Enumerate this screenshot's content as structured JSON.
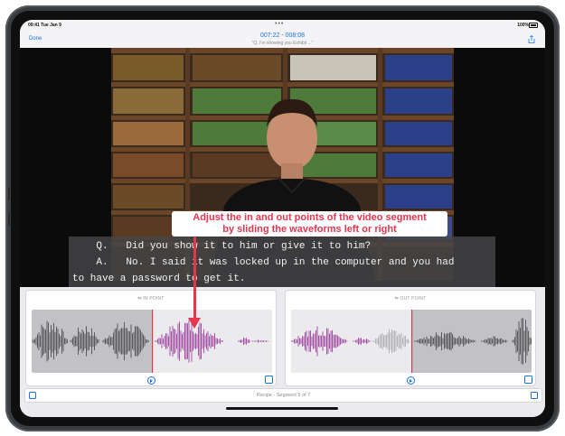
{
  "status_bar": {
    "time_date": "09:41  Tue Jan 9",
    "dots": "•••",
    "right": "100%"
  },
  "nav": {
    "done_label": "Done",
    "title": "007:22 - 008:08",
    "subtitle": "\"Q.   I'm showing you Exhibit ...\""
  },
  "subtitles": {
    "line1": "    Q.   Did you show it to him or give it to him?",
    "line2": "    A.   No. I said it was locked up in the computer and you had",
    "line3": "to have a password to get it."
  },
  "callout": {
    "line1": "Adjust the in and out points of the video segment",
    "line2": "by sliding the waveforms left or right"
  },
  "panels": {
    "in_point_label": "IN POINT",
    "out_point_label": "OUT POINT"
  },
  "segment": {
    "label": "Recipe - Segment 5 of 7"
  },
  "colors": {
    "accent": "#1a73e8",
    "callout": "#e5364f",
    "waveform_selected": "#a653a6",
    "waveform_dim": "#5b5b5e",
    "waveform_light": "#b4b4b6"
  }
}
